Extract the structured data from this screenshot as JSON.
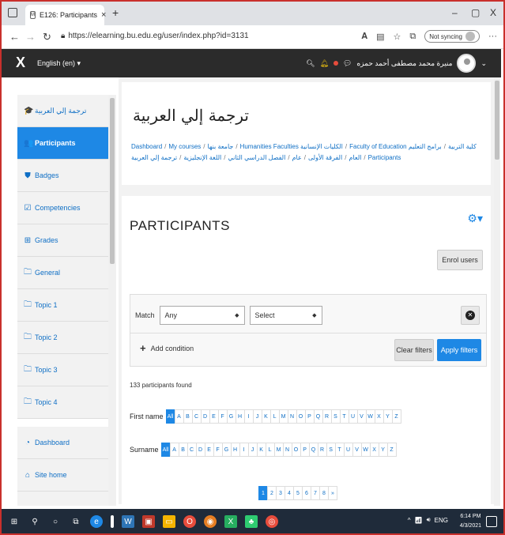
{
  "browser": {
    "tab_title": "E126: Participants",
    "url": "https://elearning.bu.edu.eg/user/index.php?id=3131",
    "sync_label": "Not syncing",
    "new_tab": "+",
    "close_tab": "×",
    "minimize": "–",
    "maximize": "▢",
    "close_window": "X"
  },
  "navbar": {
    "close_drawer": "X",
    "language": "English (en) ▾",
    "user_name": "منيرة محمد مصطفى أحمد حمزه",
    "user_caret": "⌄"
  },
  "sidebar": {
    "items": [
      {
        "label": "ترجمة إلي العربية",
        "icon": "graduation-cap-icon",
        "glyph": "🎓"
      },
      {
        "label": "Participants",
        "icon": "users-icon",
        "glyph": "👥",
        "active": true
      },
      {
        "label": "Badges",
        "icon": "shield-icon",
        "glyph": "⛊"
      },
      {
        "label": "Competencies",
        "icon": "check-square-icon",
        "glyph": "☑"
      },
      {
        "label": "Grades",
        "icon": "table-icon",
        "glyph": "⊞"
      },
      {
        "label": "General",
        "icon": "folder-icon",
        "glyph": "🗀"
      },
      {
        "label": "Topic 1",
        "icon": "folder-icon",
        "glyph": "🗀"
      },
      {
        "label": "Topic 2",
        "icon": "folder-icon",
        "glyph": "🗀"
      },
      {
        "label": "Topic 3",
        "icon": "folder-icon",
        "glyph": "🗀"
      },
      {
        "label": "Topic 4",
        "icon": "folder-icon",
        "glyph": "🗀"
      }
    ],
    "bottom_items": [
      {
        "label": "Dashboard",
        "icon": "dashboard-icon",
        "glyph": "◔"
      },
      {
        "label": "Site home",
        "icon": "home-icon",
        "glyph": "⌂"
      }
    ]
  },
  "course": {
    "title": "ترجمة إلي العربية",
    "breadcrumb": [
      "Dashboard",
      "My courses",
      "جامعة بنها",
      "Humanities Faculties الكليات الإنسانية",
      "Faculty of Education كلية التربية",
      "برامج التعليم العام",
      "الفرقة الأولى",
      "عام",
      "الفصل الدراسي الثاني",
      "اللغة الإنجليزية",
      "ترجمة إلي العربية",
      "Participants"
    ]
  },
  "participants": {
    "heading": "PARTICIPANTS",
    "enrol_label": "Enrol users",
    "match_label": "Match",
    "match_value": "Any",
    "select_value": "Select",
    "add_condition": "Add condition",
    "clear_filters": "Clear filters",
    "apply_filters": "Apply filters",
    "found_text": "133 participants found",
    "firstname_label": "First name",
    "surname_label": "Surname",
    "all_label": "All",
    "letters": [
      "A",
      "B",
      "C",
      "D",
      "E",
      "F",
      "G",
      "H",
      "I",
      "J",
      "K",
      "L",
      "M",
      "N",
      "O",
      "P",
      "Q",
      "R",
      "S",
      "T",
      "U",
      "V",
      "W",
      "X",
      "Y",
      "Z"
    ],
    "pages": [
      "1",
      "2",
      "3",
      "4",
      "5",
      "6",
      "7",
      "8",
      "»"
    ]
  },
  "taskbar": {
    "time": "6:14 PM",
    "date": "4/3/2021",
    "lang": "ENG"
  }
}
